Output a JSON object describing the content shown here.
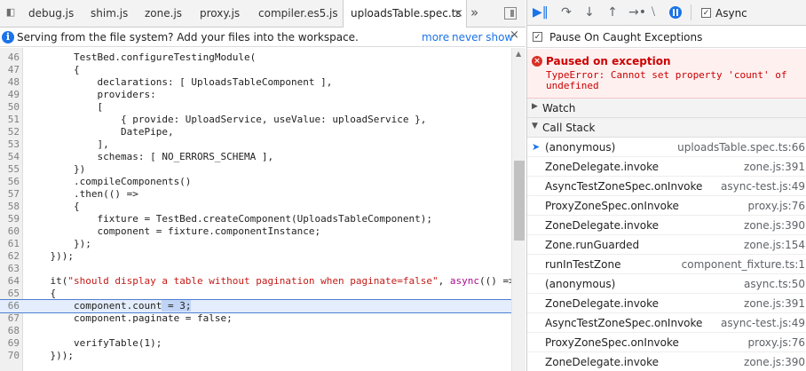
{
  "tabs": [
    {
      "label": "debug.js"
    },
    {
      "label": "shim.js"
    },
    {
      "label": "zone.js"
    },
    {
      "label": "proxy.js"
    },
    {
      "label": "compiler.es5.js"
    },
    {
      "label": "uploadsTable.spec.ts",
      "active": true
    }
  ],
  "tabs_overflow": "»",
  "infobar": {
    "message": "Serving from the file system? Add your files into the workspace.",
    "more_link": "more",
    "never_link": "never show"
  },
  "code": {
    "paused_line": 66,
    "lines": [
      {
        "n": "46",
        "text": "        TestBed.configureTestingModule("
      },
      {
        "n": "47",
        "text": "        {"
      },
      {
        "n": "48",
        "text": "            declarations: [ UploadsTableComponent ],"
      },
      {
        "n": "49",
        "text": "            providers:"
      },
      {
        "n": "50",
        "text": "            ["
      },
      {
        "n": "51",
        "text": "                { provide: UploadService, useValue: uploadService },"
      },
      {
        "n": "52",
        "text": "                DatePipe,"
      },
      {
        "n": "53",
        "text": "            ],"
      },
      {
        "n": "54",
        "text": "            schemas: [ NO_ERRORS_SCHEMA ],"
      },
      {
        "n": "55",
        "text": "        })"
      },
      {
        "n": "56",
        "text": "        .compileComponents()"
      },
      {
        "n": "57",
        "text": "        .then(() =>"
      },
      {
        "n": "58",
        "text": "        {"
      },
      {
        "n": "59",
        "text": "            fixture = TestBed.createComponent(UploadsTableComponent);"
      },
      {
        "n": "60",
        "text": "            component = fixture.componentInstance;"
      },
      {
        "n": "61",
        "text": "        });"
      },
      {
        "n": "62",
        "text": "    }));"
      },
      {
        "n": "63",
        "text": ""
      },
      {
        "n": "64",
        "pre": "    it(",
        "str": "\"should display a table without pagination when paginate=false\"",
        "mid": ", ",
        "kw": "async",
        "post": "(() =>"
      },
      {
        "n": "65",
        "text": "    {"
      },
      {
        "n": "66",
        "pre": "        component.count",
        "sel": " = 3;",
        "post": ""
      },
      {
        "n": "67",
        "text": "        component.paginate = false;"
      },
      {
        "n": "68",
        "text": ""
      },
      {
        "n": "69",
        "text": "        verifyTable(1);"
      },
      {
        "n": "70",
        "text": "    }));"
      }
    ]
  },
  "debugger": {
    "async_label": "Async",
    "async_checked": true,
    "pause_caught_label": "Pause On Caught Exceptions",
    "pause_caught_checked": true,
    "exception_title": "Paused on exception",
    "exception_message": "TypeError: Cannot set property 'count' of undefined",
    "watch_label": "Watch",
    "callstack_label": "Call Stack",
    "frames": [
      {
        "name": "(anonymous)",
        "loc": "uploadsTable.spec.ts:66",
        "current": true
      },
      {
        "name": "ZoneDelegate.invoke",
        "loc": "zone.js:391"
      },
      {
        "name": "AsyncTestZoneSpec.onInvoke",
        "loc": "async-test.js:49"
      },
      {
        "name": "ProxyZoneSpec.onInvoke",
        "loc": "proxy.js:76"
      },
      {
        "name": "ZoneDelegate.invoke",
        "loc": "zone.js:390"
      },
      {
        "name": "Zone.runGuarded",
        "loc": "zone.js:154"
      },
      {
        "name": "runInTestZone",
        "loc": "component_fixture.ts:1"
      },
      {
        "name": "(anonymous)",
        "loc": "async.ts:50"
      },
      {
        "name": "ZoneDelegate.invoke",
        "loc": "zone.js:391"
      },
      {
        "name": "AsyncTestZoneSpec.onInvoke",
        "loc": "async-test.js:49"
      },
      {
        "name": "ProxyZoneSpec.onInvoke",
        "loc": "proxy.js:76"
      },
      {
        "name": "ZoneDelegate.invoke",
        "loc": "zone.js:390"
      }
    ]
  },
  "colors": {
    "accent": "#1a73e8",
    "error": "#cc0000",
    "string": "#c41a16",
    "keyword": "#aa0d91"
  }
}
